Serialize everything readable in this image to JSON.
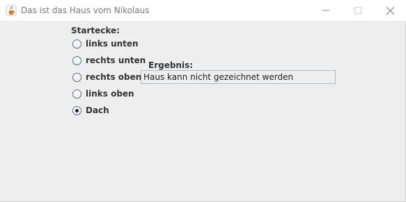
{
  "window": {
    "title": "Das ist das Haus vom Nikolaus",
    "icon": "java-cup-icon",
    "controls": [
      "minimize",
      "maximize",
      "close"
    ]
  },
  "startecke": {
    "label": "Startecke:",
    "options": [
      {
        "label": "links unten",
        "checked": false
      },
      {
        "label": "rechts unten",
        "checked": false
      },
      {
        "label": "rechts oben",
        "checked": false
      },
      {
        "label": "links oben",
        "checked": false
      },
      {
        "label": "Dach",
        "checked": true
      }
    ]
  },
  "ergebnis": {
    "label": "Ergebnis:",
    "value": "Haus kann nicht gezeichnet werden"
  }
}
